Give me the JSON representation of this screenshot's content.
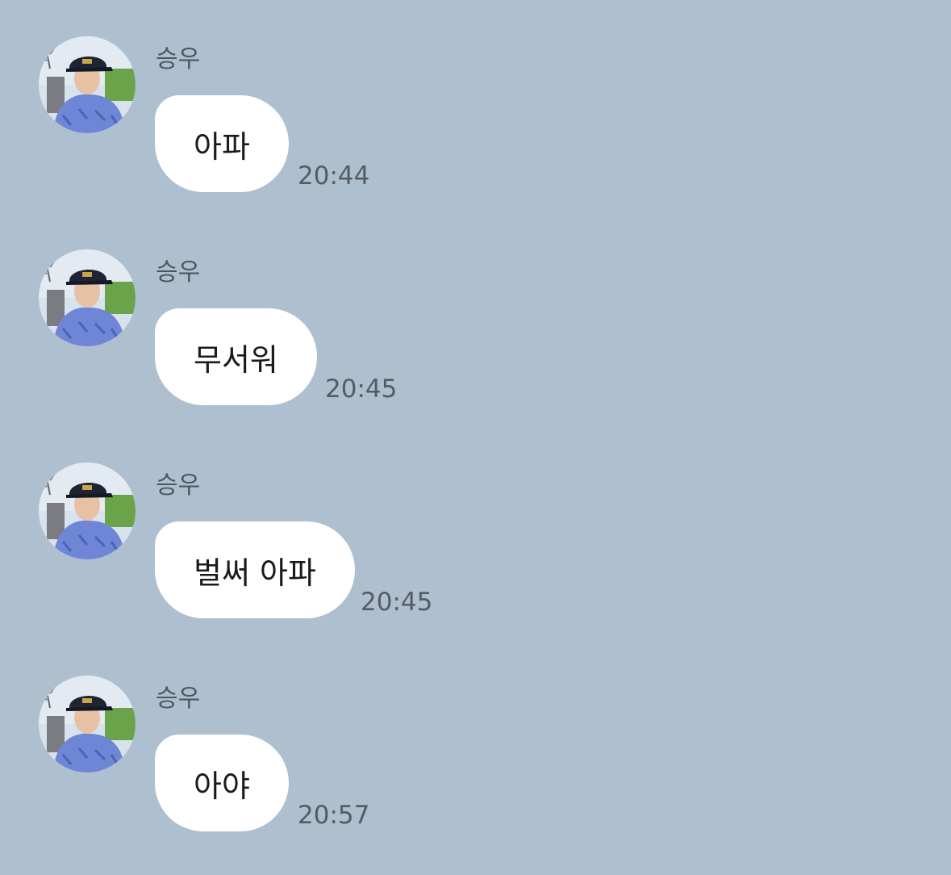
{
  "chat": {
    "background_color": "#aec0cf",
    "messages": [
      {
        "sender": "승우",
        "avatar_icon": "profile-photo-icon",
        "text": "아파",
        "time": "20:44"
      },
      {
        "sender": "승우",
        "avatar_icon": "profile-photo-icon",
        "text": "무서워",
        "time": "20:45"
      },
      {
        "sender": "승우",
        "avatar_icon": "profile-photo-icon",
        "text": "벌써 아파",
        "time": "20:45"
      },
      {
        "sender": "승우",
        "avatar_icon": "profile-photo-icon",
        "text": "아야",
        "time": "20:57"
      }
    ]
  }
}
